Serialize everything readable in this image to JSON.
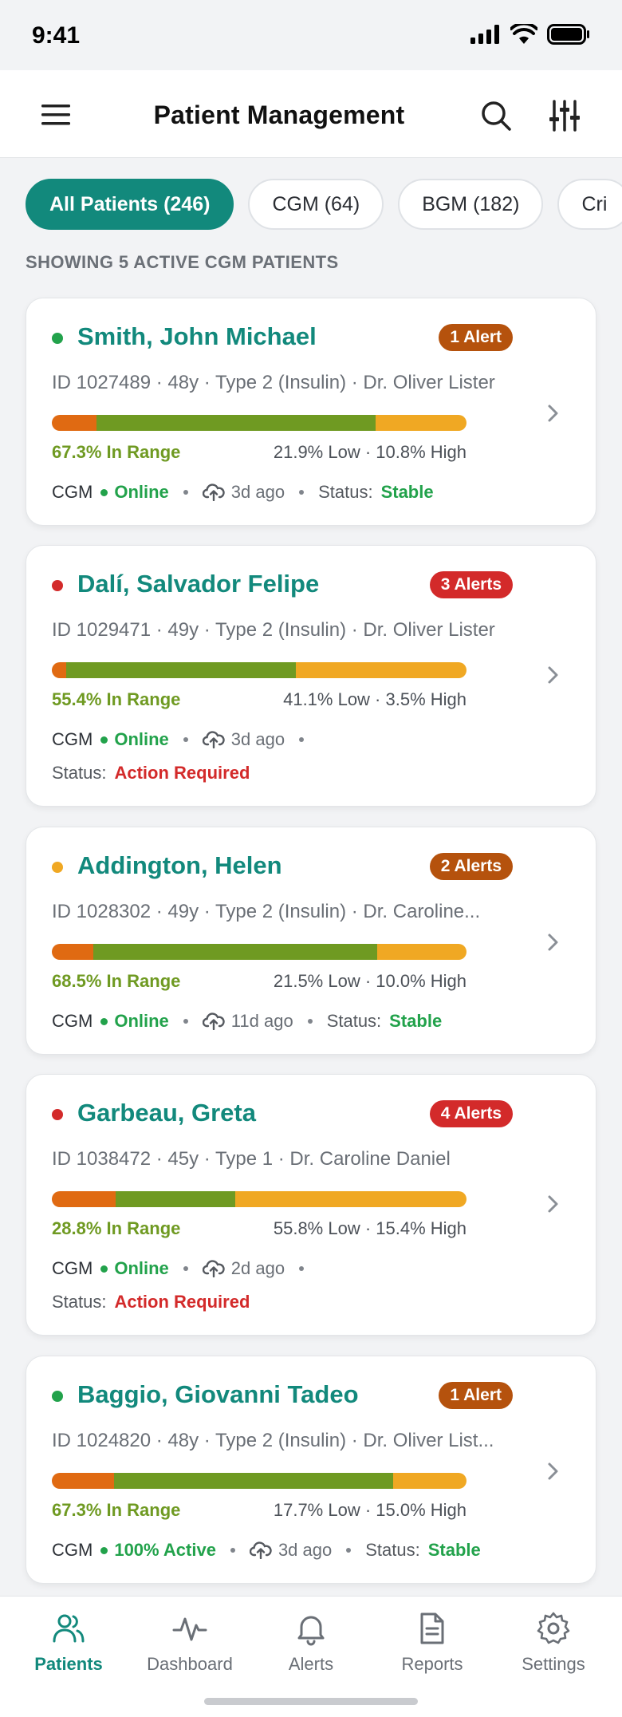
{
  "status_bar": {
    "time": "9:41"
  },
  "header": {
    "title": "Patient Management"
  },
  "filters": [
    {
      "label": "All Patients (246)",
      "active": true
    },
    {
      "label": "CGM (64)",
      "active": false
    },
    {
      "label": "BGM (182)",
      "active": false
    },
    {
      "label": "Cri",
      "active": false
    }
  ],
  "showing_text": "SHOWING 5 ACTIVE CGM PATIENTS",
  "patients": [
    {
      "name": "Smith, John Michael",
      "indicator_color": "#22a24b",
      "alert": "1 Alert",
      "alert_color": "#b5520d",
      "meta": "ID 1027489 · 48y · Type 2 (Insulin) · Dr. Oliver Lister",
      "low_pct": 10.8,
      "in_pct": 67.3,
      "high_pct": 21.9,
      "in_range": "67.3% In Range",
      "low_high": "21.9% Low · 10.8% High",
      "device": "CGM",
      "connection": "Online",
      "last_upload": "3d ago",
      "status_label": "Status:",
      "status": "Stable",
      "status_type": "stable"
    },
    {
      "name": "Dalí, Salvador Felipe",
      "indicator_color": "#d32a2a",
      "alert": "3 Alerts",
      "alert_color": "#d32a2a",
      "meta": "ID 1029471 · 49y · Type 2 (Insulin) · Dr. Oliver Lister",
      "low_pct": 3.5,
      "in_pct": 55.4,
      "high_pct": 41.1,
      "in_range": "55.4% In Range",
      "low_high": "41.1% Low · 3.5% High",
      "device": "CGM",
      "connection": "Online",
      "last_upload": "3d ago",
      "status_label": "Status:",
      "status": "Action Required",
      "status_type": "action"
    },
    {
      "name": "Addington, Helen",
      "indicator_color": "#f0a823",
      "alert": "2 Alerts",
      "alert_color": "#b5520d",
      "meta": "ID 1028302 · 49y · Type 2 (Insulin) · Dr. Caroline...",
      "low_pct": 10.0,
      "in_pct": 68.5,
      "high_pct": 21.5,
      "in_range": "68.5% In Range",
      "low_high": "21.5% Low · 10.0% High",
      "device": "CGM",
      "connection": "Online",
      "last_upload": "11d ago",
      "status_label": "Status:",
      "status": "Stable",
      "status_type": "stable"
    },
    {
      "name": "Garbeau, Greta",
      "indicator_color": "#d32a2a",
      "alert": "4 Alerts",
      "alert_color": "#d32a2a",
      "meta": "ID 1038472 · 45y · Type 1 · Dr. Caroline Daniel",
      "low_pct": 15.4,
      "in_pct": 28.8,
      "high_pct": 55.8,
      "in_range": "28.8% In Range",
      "low_high": "55.8% Low · 15.4% High",
      "device": "CGM",
      "connection": "Online",
      "last_upload": "2d ago",
      "status_label": "Status:",
      "status": "Action Required",
      "status_type": "action"
    },
    {
      "name": "Baggio, Giovanni Tadeo",
      "indicator_color": "#22a24b",
      "alert": "1 Alert",
      "alert_color": "#b5520d",
      "meta": "ID 1024820 · 48y · Type 2 (Insulin) · Dr. Oliver List...",
      "low_pct": 15.0,
      "in_pct": 67.3,
      "high_pct": 17.7,
      "in_range": "67.3% In Range",
      "low_high": "17.7% Low · 15.0% High",
      "device": "CGM",
      "connection": "100% Active",
      "last_upload": "3d ago",
      "status_label": "Status:",
      "status": "Stable",
      "status_type": "stable"
    }
  ],
  "tabs": [
    {
      "label": "Patients",
      "icon": "patients-icon",
      "active": true
    },
    {
      "label": "Dashboard",
      "icon": "dashboard-icon",
      "active": false
    },
    {
      "label": "Alerts",
      "icon": "bell-icon",
      "active": false
    },
    {
      "label": "Reports",
      "icon": "report-icon",
      "active": false
    },
    {
      "label": "Settings",
      "icon": "gear-icon",
      "active": false
    }
  ],
  "colors": {
    "accent": "#12897c",
    "in_range": "#6f9a22",
    "low": "#e06a12",
    "high": "#f0a823"
  }
}
